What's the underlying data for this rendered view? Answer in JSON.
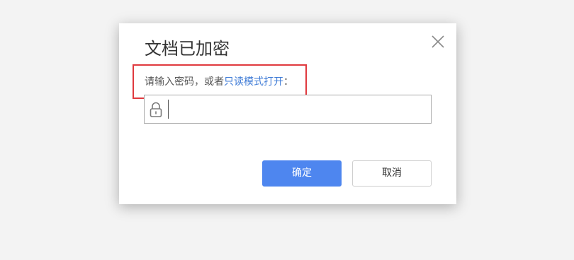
{
  "dialog": {
    "title": "文档已加密",
    "prompt_prefix": "请输入密码，或者",
    "prompt_link": "只读模式打开",
    "prompt_suffix": "：",
    "password": {
      "value": "",
      "placeholder": ""
    },
    "ok_label": "确定",
    "cancel_label": "取消"
  },
  "icons": {
    "close": "close-icon",
    "lock": "lock-icon"
  },
  "colors": {
    "primary": "#4e86ef",
    "link": "#3d7ad6",
    "highlight_border": "#e0393e",
    "background": "#f3f3f3"
  }
}
